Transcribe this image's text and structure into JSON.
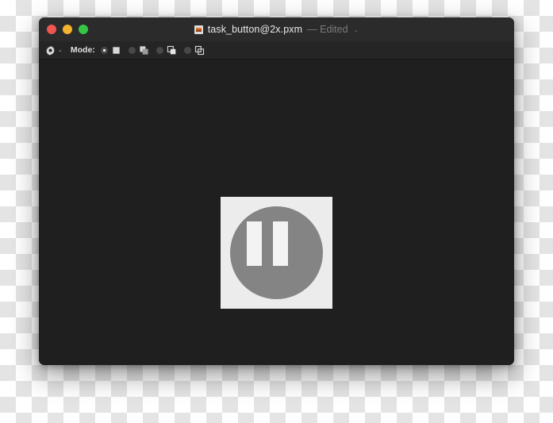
{
  "window": {
    "traffic_lights": [
      {
        "name": "close",
        "label": "Close",
        "color": "#f0564f"
      },
      {
        "name": "minimize",
        "label": "Minimize",
        "color": "#f5b32c"
      },
      {
        "name": "maximize",
        "label": "Zoom",
        "color": "#38c546"
      }
    ],
    "title": {
      "doc_icon": "pixelmator-document-icon",
      "filename": "task_button@2x.pxm",
      "separator_and_state": "— Edited",
      "chevron": "⌄"
    }
  },
  "toolbar": {
    "settings": {
      "icon": "gear-icon",
      "chevron": "⌄"
    },
    "mode_label": "Mode:",
    "modes": [
      {
        "name": "new-shape",
        "icon": "filled-square-icon",
        "selected": true
      },
      {
        "name": "add-shape",
        "icon": "union-shapes-icon",
        "selected": false
      },
      {
        "name": "subtract-shape",
        "icon": "subtract-shapes-icon",
        "selected": false
      },
      {
        "name": "intersect-shape",
        "icon": "intersect-shapes-icon",
        "selected": false
      }
    ]
  },
  "canvas": {
    "background_color": "#1f1f1f",
    "artboard": {
      "name": "pause-button-artwork",
      "background_color": "#ececec",
      "circle_color": "#848484",
      "bar_color": "#f3f3f3",
      "bars": 2
    }
  }
}
